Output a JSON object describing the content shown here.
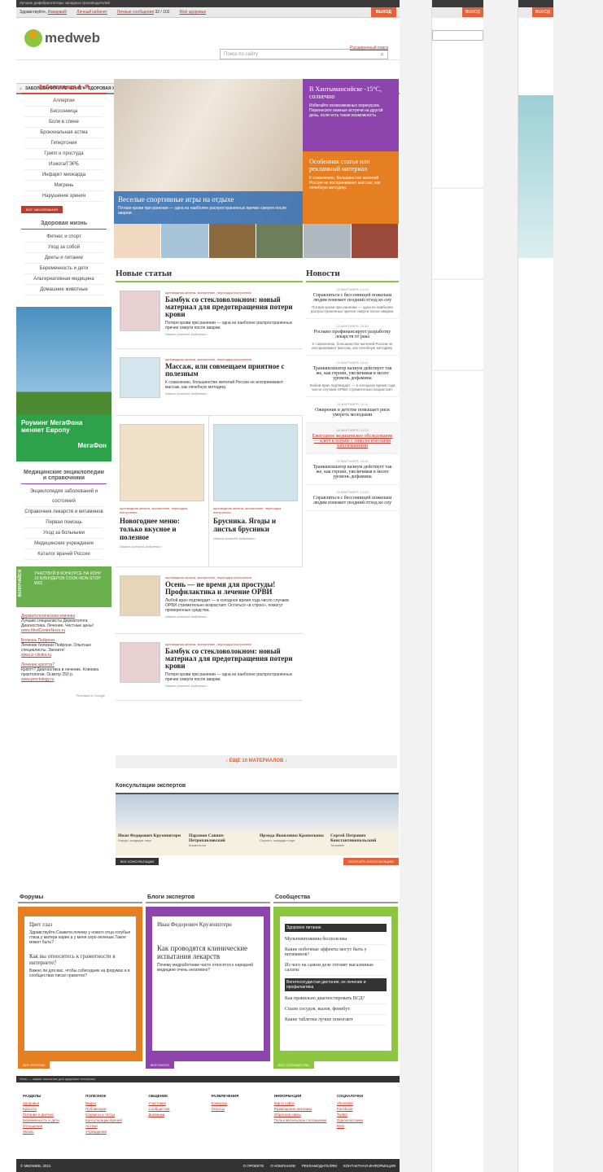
{
  "topbar": {
    "text": "Лучшие дефибрилляторы западных производителей"
  },
  "user": {
    "greeting": "Здравствуйте,",
    "name": "Изварвай!",
    "cabinet": "Личный кабинет",
    "messages": "Личные сообщения",
    "msg_count": "32 / 102",
    "health": "Моё здоровье",
    "exit": "ВЫХОД"
  },
  "logo": "medweb",
  "search": {
    "placeholder": "Поиск по сайту",
    "advanced": "Расширенный поиск"
  },
  "nav": [
    "ЗАБОЛЕВАНИЯ И ЛЕЧЕНИЕ",
    "ЗДОРОВАЯ ЖИЗНЬ",
    "КРАСОТА И УХОД",
    "ДИЕТЫ И ПИТАНИЕ",
    "БЕРЕМЕННОСТЬ И ДЕТИ",
    "КОНСУЛЬТАЦИИ",
    "СООБЩЕСТВА",
    "СКИДКИ"
  ],
  "diseases": {
    "title": "Заболевания А–Я",
    "items": [
      "Аллергии",
      "Бессонница",
      "Боли в спине",
      "Бронхиальная астма",
      "Гипертония",
      "Грипп и простуда",
      "Изжога/ГЭРБ",
      "Инфаркт миокарда",
      "Мигрень",
      "Нарушение зрения"
    ],
    "all": "ВСЕ ЗАБОЛЕВАНИЯ"
  },
  "healthy": {
    "title": "Здоровая жизнь",
    "items": [
      "Фитнес и спорт",
      "Уход за собой",
      "Диеты и питание",
      "Беременность и дети",
      "Альтернативная медицина",
      "Домашние животные"
    ]
  },
  "megafon": {
    "text": "Роуминг МегаФона меняет Европу",
    "brand": "МегаФон"
  },
  "encyc": {
    "title": "Медицинские энциклопедии и справочники",
    "items": [
      "Энциклопедия заболеваний и состояний",
      "Справочник лекарств и витаминов",
      "Первая помощь",
      "Уход за больными",
      "Медицинские учреждения",
      "Каталог врачей России"
    ]
  },
  "contest": "УЧАСТВУЙ В КОНКУРСЕ НА КОНУ 10 БЛЕНДЕРОВ COOK-NON-STOP W62",
  "contest_side": "ВКЛЮЧАЙСЯ",
  "ads": [
    {
      "t": "Дерматологическая клиника",
      "d": "Лучшие специалисты Дерматолога Диагностика. Лечение. Честные цены!",
      "u": "www.MedCentreNovo.ru"
    },
    {
      "t": "Болезнь Пейрони.",
      "d": "Лечение болезни Пейрони. Опытные специалисты. Звоните!",
      "u": "www.iz-clinika.ru"
    },
    {
      "t": "Лечение кріпітта?",
      "d": "Кріпітт? Диагностика в лечение. Клиника проктологии. Осмотр 250 р.",
      "u": "www.proctology.ru"
    }
  ],
  "ads_label": "Реклама от Google",
  "slide": {
    "title": "Веселые спортивные игры на отдыхе",
    "desc": "Потеря крови при ранении — одна из наиболее распространенных причин смерти после аварии."
  },
  "tiles": [
    {
      "title": "В Хантымансийске -15°C, солнечно",
      "desc": "Избегайте всевозможных перегрузок. Перенесите важные встречи на другой день, если есть такая возможность.",
      "color": "#8e44ad"
    },
    {
      "title": "Особенная статья или рекламный материал",
      "desc": "К сожалению, большинство жителей России не воспринимают массаж, как лечебную методику.",
      "color": "#e67e22"
    }
  ],
  "new_articles": {
    "title": "Новые статьи",
    "tags": "щитовидная железа, воспаление, пересадка настроения",
    "author": "Иванов Алексей Андреевич",
    "items": [
      {
        "t": "Бамбук со стекловолокном: новый материал для предотвращения потери крови",
        "d": "Потеря крови при ранении — одна из наиболее распространенных причин смерти после аварии."
      },
      {
        "t": "Массаж, или совмещаем приятное с полезным",
        "d": "К сожалению, большинство жителей России не воспринимают массаж, как лечебную методику."
      },
      {
        "t": "Новогоднее меню: только вкусное и полезное",
        "d": ""
      },
      {
        "t": "Брусника. Ягоды и листья брусники",
        "d": ""
      },
      {
        "t": "Осень — не время для простуды! Профилактика и лечение ОРВИ",
        "d": "Любой врач подтвердит — в холодное время года число случаев ОРВИ стремительно возрастает. Остаться «в строю», помогут проверенные средства."
      },
      {
        "t": "Бамбук со стекловолокном: новый материал для предотвращения потери крови",
        "d": "Потеря крови при ранении — одна из наиболее распространенных причин смерти после аварии."
      }
    ]
  },
  "news": {
    "title": "Новости",
    "items": [
      {
        "dt": "23 МАРТАВРЯ, 14:23",
        "t": "Справляться с бессонницей пожилым людям поможет поздний отход ко сну",
        "d": "Потеря крови при ранении — одна из наиболее распространенных причин смерти после аварии."
      },
      {
        "dt": "23 МАРТАВРЯ, 20:50",
        "t": "Роснано профинансирует разработку лекарств от рака",
        "d": "К сожалению, большинство жителей России не воспринимают массаж, как лечебную методику."
      },
      {
        "dt": "23 МАРТАВРЯ, 18:41",
        "t": "Транквилизатор валиум действует так же, как героин, увеличивая в мозге уровень дофамина",
        "d": "Любой врач подтвердит — в холодное время года число случаев ОРВИ стремительно возрастает."
      },
      {
        "dt": "23 МАРТАВРЯ, 12:11",
        "t": "Ожирение в детстве повышает риск умереть молодыми",
        "d": ""
      },
      {
        "dt": "28 МАРТАВРЯ, 13:23",
        "t": "Ежегодное медицинское обследование — ключ к борьбе с онкологическими заболеваниями",
        "d": ""
      },
      {
        "dt": "23 МАРТАВРЯ, 18:41",
        "t": "Транквилизатор валиум действует так же, как героин, увеличивая в мозге уровень дофамина",
        "d": ""
      },
      {
        "dt": "23 МАРТАВРЯ, 14:53",
        "t": "Справляться с бессонницей пожилым людям поможет поздний отход ко сну",
        "d": ""
      }
    ]
  },
  "more": "↓ ЕЩЕ 10 МАТЕРИАЛОВ ↓",
  "experts": {
    "title": "Консультации экспертов",
    "items": [
      {
        "n": "Иван Федорович Крузенштерн",
        "s": "Хирург, кандидат наук"
      },
      {
        "n": "Парамон Саввич Петропавловский",
        "s": "Косметолог"
      },
      {
        "n": "Ирэнда Яковлевна Кропоткина",
        "s": "Окулист, кандидат наук"
      },
      {
        "n": "Сергей Петрович Константинопольский",
        "s": "Терапевт"
      }
    ],
    "all": "ВСЕ КОНСУЛЬТАЦИИ",
    "get": "ПОЛУЧИТЬ КОНСУЛЬТАЦИЮ"
  },
  "forums": {
    "title": "Форумы",
    "q1": "Цвет глаз",
    "q1d": "Здравствуйте.Скажите,почему у нового отца голубые глаза,у матери карие,а у меня серо-зеленые.Такое может быть?",
    "q2": "Как вы относитесь к грамотности в интернете?",
    "q2d": "Важно ли для вас, чтобы собеседник на форумах и в сообществах писал грамотно?",
    "all": "ВСЕ ФОРУМЫ"
  },
  "blogs": {
    "title": "Блоги экспертов",
    "author": "Иван Федорович Крузенштерн",
    "post": "Как проводятся клинические испытания лекарств",
    "d": "Почему медработники часто относятся к народной медицине очень негативно?",
    "all": "ВСЕ БЛОГИ"
  },
  "communities": {
    "title": "Сообщества",
    "cat1": "Здоровое питание",
    "items1": [
      "Мультивитамины бесполезны",
      "Какие побочные эффекты могут быть у витаминов?",
      "Из чего на самом деле готовят магазинные салаты"
    ],
    "cat2": "Вегетососудистая дистония, ее лечение и профилактика",
    "items2": [
      "Как правильно диагностировать ВСД?",
      "Спазм сосудов, вызов, фенибут.",
      "Какие таблетки лучше помогают"
    ],
    "all": "ВСЕ СООБЩЕСТВА"
  },
  "bar": "Vertu — самые полезные для здоровья телефоны",
  "footer": [
    {
      "h": "РАЗДЕЛЫ",
      "l": [
        "Здоровье",
        "Красота",
        "Питание и фитнес",
        "Беременность и дети",
        "Отношения",
        "Жизнь"
      ]
    },
    {
      "h": "ПОЛЕЗНОЕ",
      "l": [
        "Видео",
        "Публикации",
        "Сервисы и тесты",
        "Консультации врачей",
        "Аптеки",
        "Учреждения"
      ]
    },
    {
      "h": "ОБЩЕНИЕ",
      "l": [
        "Участники",
        "Сообщества",
        "Дневники"
      ]
    },
    {
      "h": "РАЗВЛЕЧЕНИЯ",
      "l": [
        "Конкурсы",
        "Опросы"
      ]
    },
    {
      "h": "ИНФОРМАЦИЯ",
      "l": [
        "Карта сайта",
        "Размещение рекламы",
        "Обратная связь",
        "Пользовательское соглашение"
      ]
    },
    {
      "h": "СОЦИАЛОЧКИ",
      "l": [
        "Vkontakte",
        "Facebook",
        "Twitter",
        "Одноклассники",
        "RSS"
      ]
    }
  ],
  "copyright": "© MEDWEB, 2012",
  "fbar": [
    "О ПРОЕКТЕ",
    "О КОМПАНИИ",
    "РЕКЛАМОДАТЕЛЯМ",
    "КОНТАКТНАЯ ИНФОРМАЦИЯ"
  ]
}
